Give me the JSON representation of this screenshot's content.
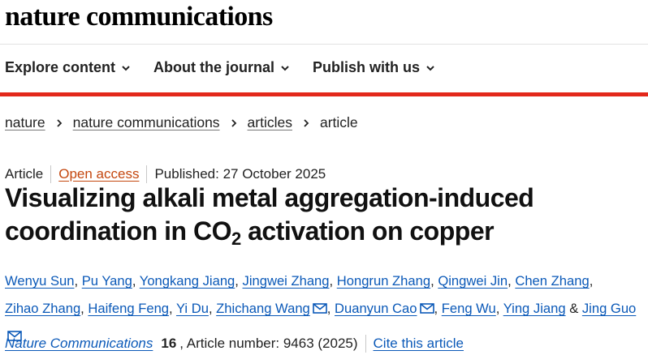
{
  "site": {
    "brand": "nature communications"
  },
  "nav": {
    "items": [
      {
        "label": "Explore content",
        "icon": "chevron-down-icon"
      },
      {
        "label": "About the journal",
        "icon": "chevron-down-icon"
      },
      {
        "label": "Publish with us",
        "icon": "chevron-down-icon"
      }
    ]
  },
  "colors": {
    "accent_bar": "#e3281b",
    "link": "#0b59b8",
    "open_access": "#c4470f"
  },
  "breadcrumb": {
    "items": [
      "nature",
      "nature communications",
      "articles"
    ],
    "current": "article"
  },
  "article": {
    "type": "Article",
    "access": "Open access",
    "published": "Published: 27 October 2025",
    "title_line1": "Visualizing alkali metal aggregation-induced",
    "title_line2_pre": "coordination in CO",
    "title_line2_sub": "2",
    "title_line2_post": " activation on copper"
  },
  "authors": [
    {
      "name": "Wenyu Sun",
      "email": false
    },
    {
      "name": "Pu Yang",
      "email": false
    },
    {
      "name": "Yongkang Jiang",
      "email": false
    },
    {
      "name": "Jingwei Zhang",
      "email": false
    },
    {
      "name": "Hongrun Zhang",
      "email": false
    },
    {
      "name": "Qingwei Jin",
      "email": false
    },
    {
      "name": "Chen Zhang",
      "email": false
    },
    {
      "name": "Zihao Zhang",
      "email": false
    },
    {
      "name": "Haifeng Feng",
      "email": false
    },
    {
      "name": "Yi Du",
      "email": false
    },
    {
      "name": "Zhichang Wang",
      "email": true
    },
    {
      "name": "Duanyun Cao",
      "email": true
    },
    {
      "name": "Feng Wu",
      "email": false
    },
    {
      "name": "Ying Jiang",
      "email": false
    },
    {
      "name": "Jing Guo",
      "email": true
    }
  ],
  "citation": {
    "journal": "Nature Communications",
    "volume": "16",
    "article_number": ", Article number: 9463 (2025)",
    "cite_label": "Cite this article"
  }
}
